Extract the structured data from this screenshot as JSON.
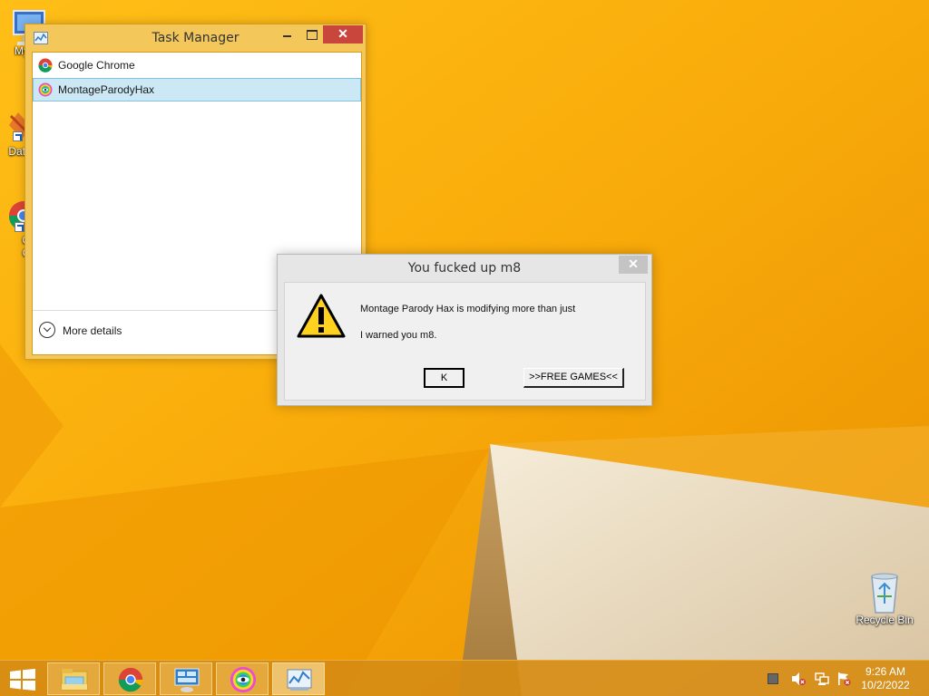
{
  "desktop": {
    "icons": [
      {
        "label": "My C",
        "name": "my-computer"
      },
      {
        "label": "Data",
        "name": "data-shortcut"
      },
      {
        "label": "G\nC",
        "name": "chrome-shortcut"
      },
      {
        "label": "Recycle Bin",
        "name": "recycle-bin"
      }
    ]
  },
  "task_manager": {
    "title": "Task Manager",
    "close_label": "✕",
    "processes": [
      {
        "label": "Google Chrome",
        "icon": "chrome-icon",
        "selected": false
      },
      {
        "label": "MontageParodyHax",
        "icon": "montage-hax-icon",
        "selected": true
      }
    ],
    "more_details_label": "More details"
  },
  "dialog": {
    "title": "You fucked up m8",
    "close_label": "✕",
    "message_line1": "Montage Parody Hax is modifying more than just",
    "message_line2": "I warned you m8.",
    "icon": "warning-icon",
    "buttons": {
      "ok_label": "K",
      "free_games_label": ">>FREE GAMES<<"
    }
  },
  "taskbar": {
    "pinned": [
      {
        "name": "file-explorer",
        "icon": "folder-icon"
      },
      {
        "name": "google-chrome",
        "icon": "chrome-icon"
      },
      {
        "name": "remote-desktop",
        "icon": "remote-desktop-icon"
      },
      {
        "name": "montage-parody-hax",
        "icon": "montage-hax-icon"
      },
      {
        "name": "task-manager",
        "icon": "task-manager-icon",
        "active": true
      }
    ],
    "tray": [
      "action-center-icon",
      "volume-muted-icon",
      "network-icon",
      "flag-error-icon"
    ],
    "clock": {
      "time": "9:26 AM",
      "date": "10/2/2022"
    }
  },
  "colors": {
    "wallpaper_orange": "#f6a800",
    "selection_blue": "#cce8f4",
    "close_red": "#c9463d"
  }
}
